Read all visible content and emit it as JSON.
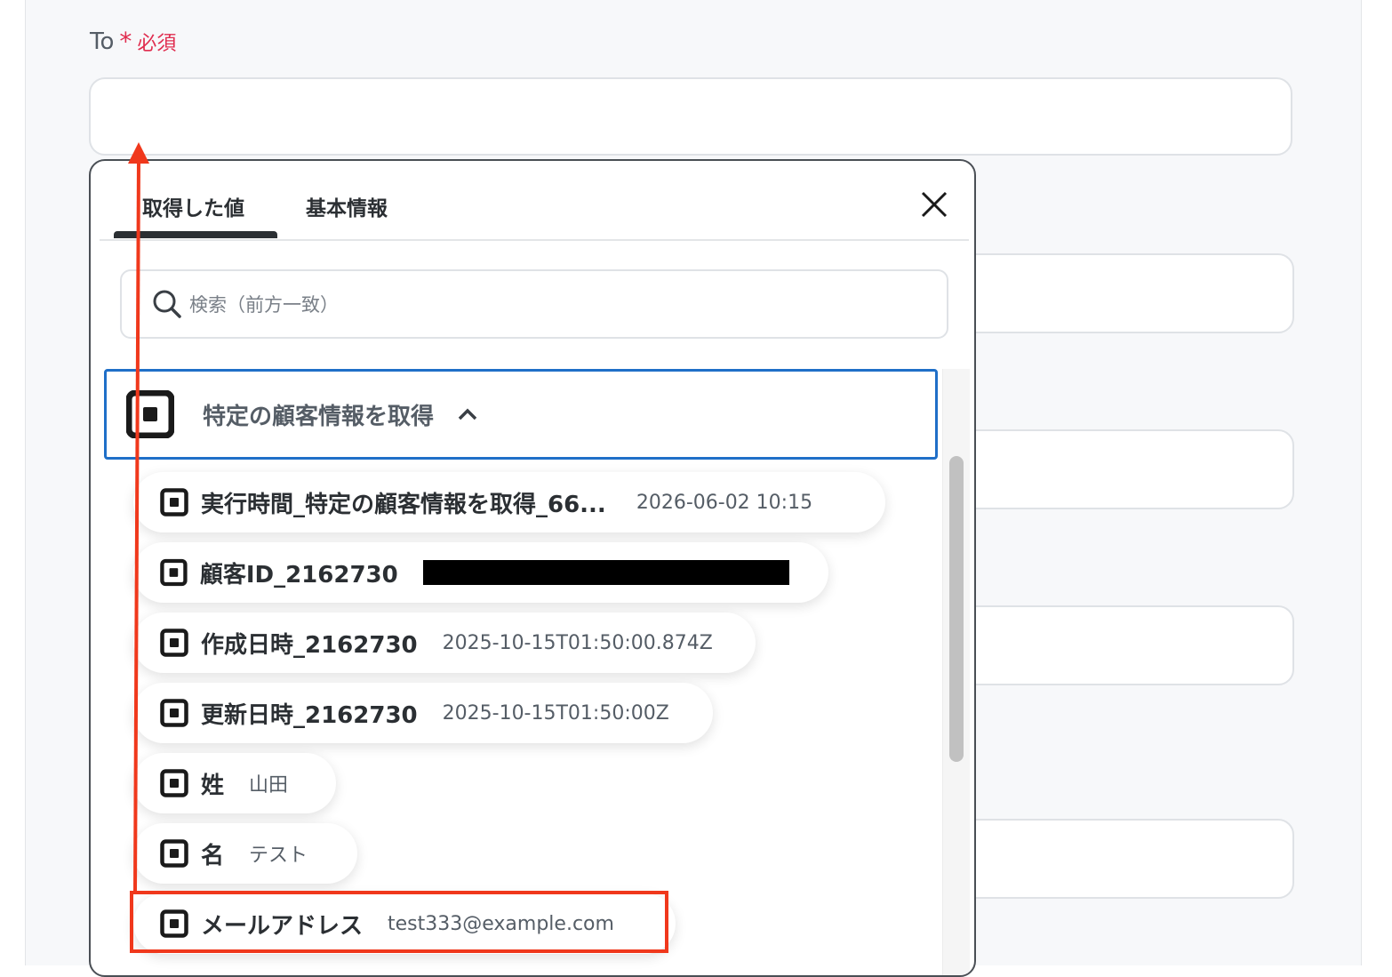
{
  "form": {
    "to_label": "To",
    "required_star": "*",
    "required_text": "必須"
  },
  "popup": {
    "tabs": [
      {
        "label": "取得した値",
        "active": true
      },
      {
        "label": "基本情報",
        "active": false
      }
    ],
    "search_placeholder": "検索（前方一致）",
    "group_title": "特定の顧客情報を取得",
    "items": [
      {
        "label": "実行時間_特定の顧客情報を取得_66...",
        "value": "2026-06-02 10:15"
      },
      {
        "label": "顧客ID_2162730",
        "value": ""
      },
      {
        "label": "作成日時_2162730",
        "value": "2025-10-15T01:50:00.874Z"
      },
      {
        "label": "更新日時_2162730",
        "value": "2025-10-15T01:50:00Z"
      },
      {
        "label": "姓",
        "value": "山田"
      },
      {
        "label": "名",
        "value": "テスト"
      },
      {
        "label": "メールアドレス",
        "value": "test333@example.com"
      }
    ]
  },
  "colors": {
    "required": "#e02d4f",
    "focus_border": "#1f6fc8",
    "annotation_red": "#f0381c"
  }
}
